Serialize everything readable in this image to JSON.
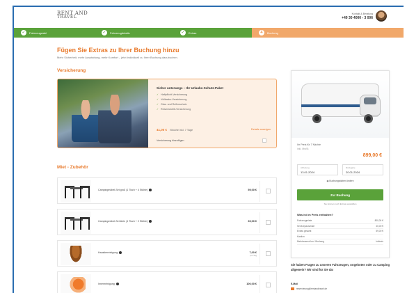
{
  "header": {
    "logo_line1": "RENT AND",
    "logo_line2": "TRAVEL",
    "contact_label": "Kontakt & Beratung",
    "contact_phone": "+49 30 4000 - 3 006"
  },
  "steps": [
    {
      "label": "Fahrzeugwahl",
      "state": "done"
    },
    {
      "label": "Fahrzeugdetails",
      "state": "done"
    },
    {
      "label": "Extras",
      "state": "done"
    },
    {
      "label": "Buchung",
      "state": "active"
    }
  ],
  "page": {
    "title": "Fügen Sie Extras zu Ihrer Buchung hinzu",
    "intro": "Mehr Sicherheit, mehr Ausstattung, mehr Komfort – jetzt individuell zu Ihrer Buchung dazubuchen."
  },
  "insurance": {
    "section_title": "Versicherung",
    "title": "Sicher unterwegs – Ihr Urlaubs-Schutz-Paket",
    "items": [
      "Haftpflicht-Versicherung",
      "Vollkasko-Versicherung",
      "Glas- und Reifenschutz",
      "Reiserücktritt-Versicherung"
    ],
    "price": "41,00 €",
    "price_unit": "/Woche inkl. 7 Tage",
    "more_link": "Details anzeigen",
    "checkbox_label": "Versicherung hinzufügen"
  },
  "rental": {
    "section_title": "Miet - Zubehör",
    "items": [
      {
        "name": "Campingmöbel-Set groß (1 Tisch + 4 Stühle)",
        "price": "59,00 €",
        "sub": ""
      },
      {
        "name": "Campingmöbel-Set klein (1 Tisch + 2 Stühle)",
        "price": "39,00 €",
        "sub": ""
      },
      {
        "name": "Haustierreinigung",
        "price": "7,00 €",
        "sub": "pro Tag"
      },
      {
        "name": "Innenreinigung",
        "price": "100,00 €",
        "sub": ""
      }
    ]
  },
  "sidebar": {
    "label": "Ihr Preis für 7 Nächte",
    "sub": "inkl. MwSt.",
    "price": "899,00 €",
    "pickup_label": "Abholung",
    "pickup_date": "13.01.2024",
    "return_label": "Rückgabe",
    "return_date": "20.01.2024",
    "change_link": "Buchungsdaten ändern",
    "cta": "Zur Buchung",
    "cta_note": "Sie können noch Extras auswählen",
    "incl_title": "Was ist im Preis enthalten?",
    "incl_rows": [
      {
        "label": "Fahrzeugmiete",
        "value": "800,00 €"
      },
      {
        "label": "Servicepauschale",
        "value": "40,00 €"
      },
      {
        "label": "Extras gesamt",
        "value": "59,00 €"
      },
      {
        "label": "Kaution",
        "value": ""
      },
      {
        "label": "Mehrtausend km / Buchung",
        "value": "Inklusiv"
      }
    ]
  },
  "faq": {
    "text": "Sie haben Fragen zu unseren Fahrzeugen, Angeboten oder zu Camping allgemein? Wir sind für Sie da!",
    "mail_label": "E-Mail",
    "mail_value": "reservierung@rentandtravel.de"
  },
  "colors": {
    "accent": "#e8792b",
    "done": "#5aa23a",
    "active_step": "#f1a86a",
    "frame": "#2a6db0"
  }
}
